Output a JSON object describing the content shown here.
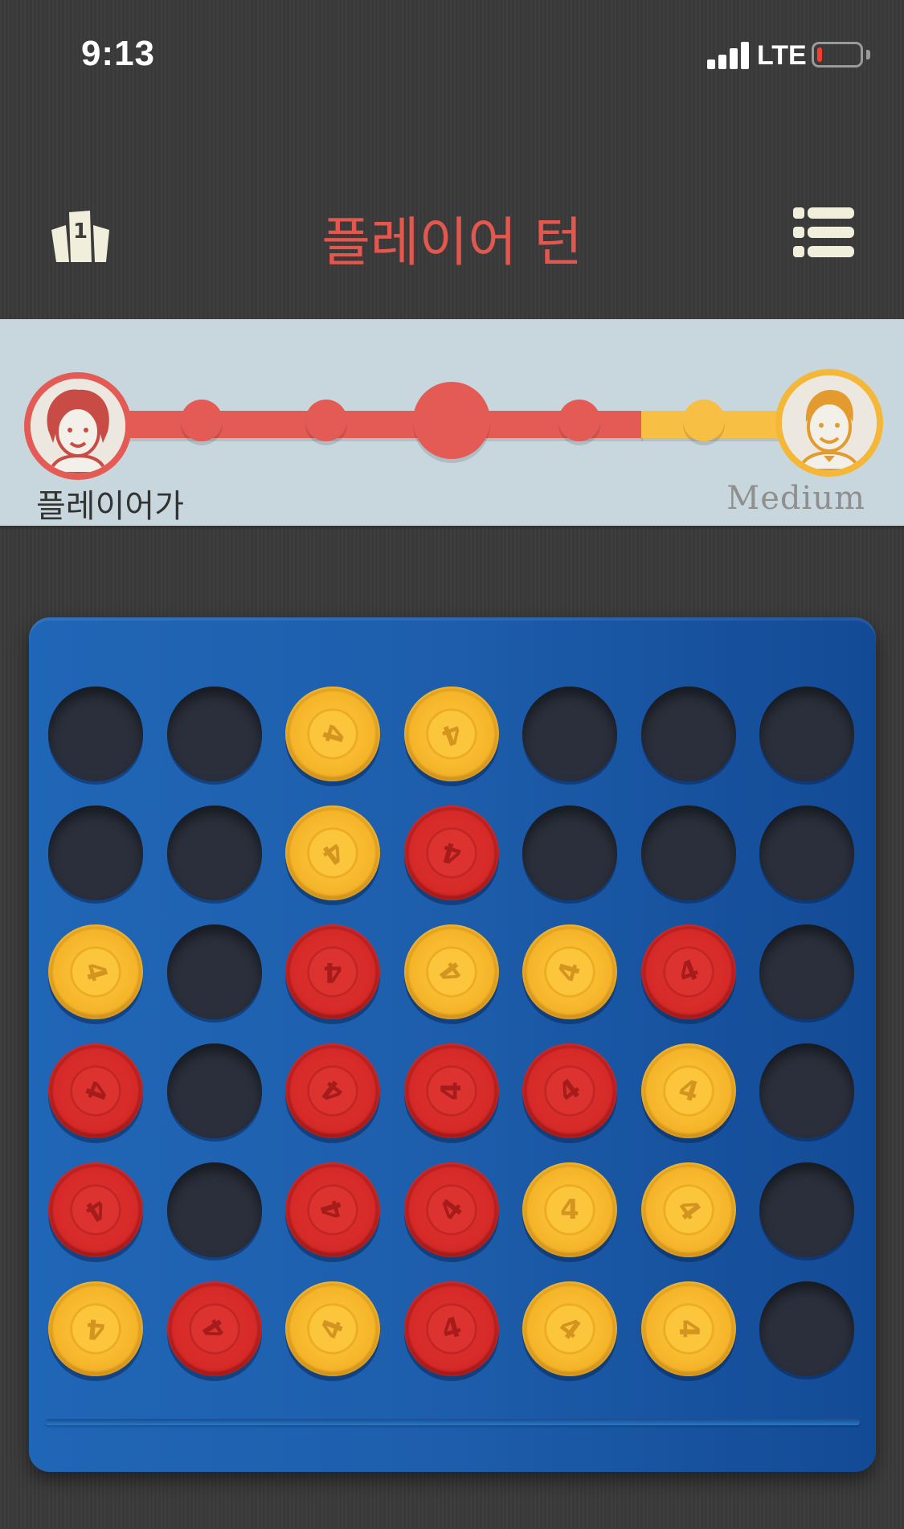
{
  "status_bar": {
    "time": "9:13",
    "network": "LTE",
    "battery_level_fraction": 0.1,
    "battery_color": "#ff3b30"
  },
  "header": {
    "title": "플레이어 턴",
    "title_color": "#e2574e",
    "leaderboard_icon": "leaderboard-podium-icon",
    "menu_icon": "menu-list-icon"
  },
  "progress": {
    "player_name": "플레이어가",
    "player_color": "#e45b55",
    "opponent_name": "Medium",
    "opponent_color": "#f5b737",
    "player_avatar_icon": "girl-avatar-icon",
    "opponent_avatar_icon": "boy-avatar-icon"
  },
  "board": {
    "columns": 7,
    "rows": 6,
    "disc_glyph": "4",
    "grid": [
      [
        "empty",
        "empty",
        "yellow",
        "yellow",
        "empty",
        "empty",
        "empty"
      ],
      [
        "empty",
        "empty",
        "yellow",
        "red",
        "empty",
        "empty",
        "empty"
      ],
      [
        "yellow",
        "empty",
        "red",
        "yellow",
        "yellow",
        "red",
        "empty"
      ],
      [
        "red",
        "empty",
        "red",
        "red",
        "red",
        "yellow",
        "empty"
      ],
      [
        "red",
        "empty",
        "red",
        "red",
        "yellow",
        "yellow",
        "empty"
      ],
      [
        "yellow",
        "red",
        "yellow",
        "red",
        "yellow",
        "yellow",
        "empty"
      ]
    ],
    "colors": {
      "yellow": "#f8bc32",
      "red": "#d82d2b",
      "board": "#1e5fad"
    }
  }
}
